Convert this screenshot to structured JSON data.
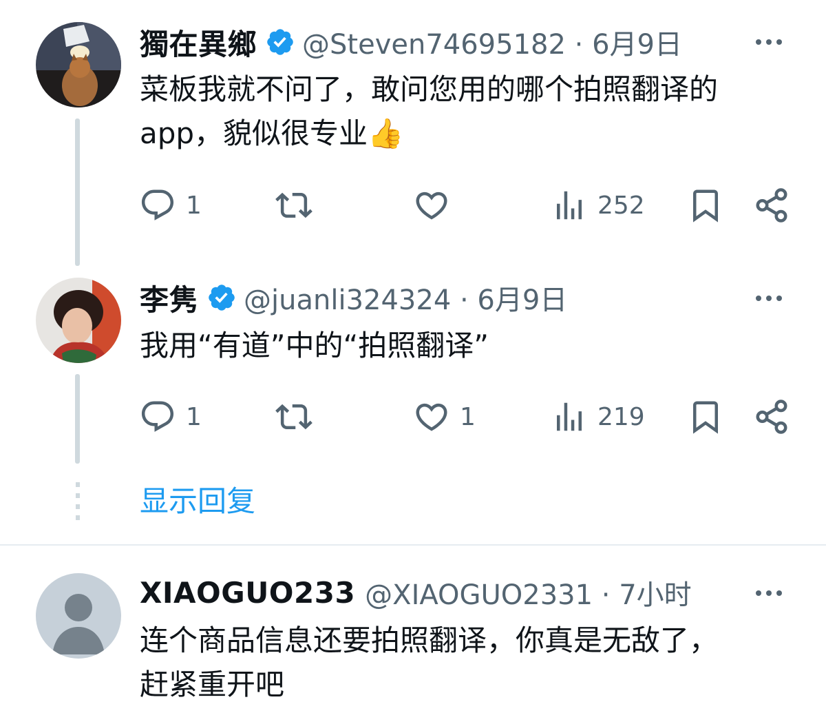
{
  "tweets": [
    {
      "name": "獨在異鄉",
      "handle_date": "@Steven74695182 · 6月9日",
      "text_line1": "菜板我就不问了，敢问您用的哪个拍照翻译的",
      "text_line2": "app，貌似很专业",
      "emoji": "👍",
      "replies": "1",
      "retweets": "",
      "likes": "",
      "views": "252"
    },
    {
      "name": "李隽",
      "handle_date": "@juanli324324 · 6月9日",
      "text_line1": "我用“有道”中的“拍照翻译”",
      "replies": "1",
      "retweets": "",
      "likes": "1",
      "views": "219"
    },
    {
      "name": "XIAOGUO233",
      "handle_date": "@XIAOGUO2331 · 7小时",
      "text_line1": "连个商品信息还要拍照翻译，你真是无敌了，",
      "text_line2": "赶紧重开吧"
    }
  ],
  "show_replies_label": "显示回复",
  "icons": {
    "reply": "reply-icon",
    "retweet": "retweet-icon",
    "like": "heart-icon",
    "views": "views-icon",
    "bookmark": "bookmark-icon",
    "share": "share-icon",
    "verified": "verified-badge-icon",
    "more": "more-icon"
  },
  "colors": {
    "accent": "#1d9bf0",
    "secondary_text": "#536471",
    "thread_line": "#cfd9de",
    "verified": "#1d9bf0"
  }
}
